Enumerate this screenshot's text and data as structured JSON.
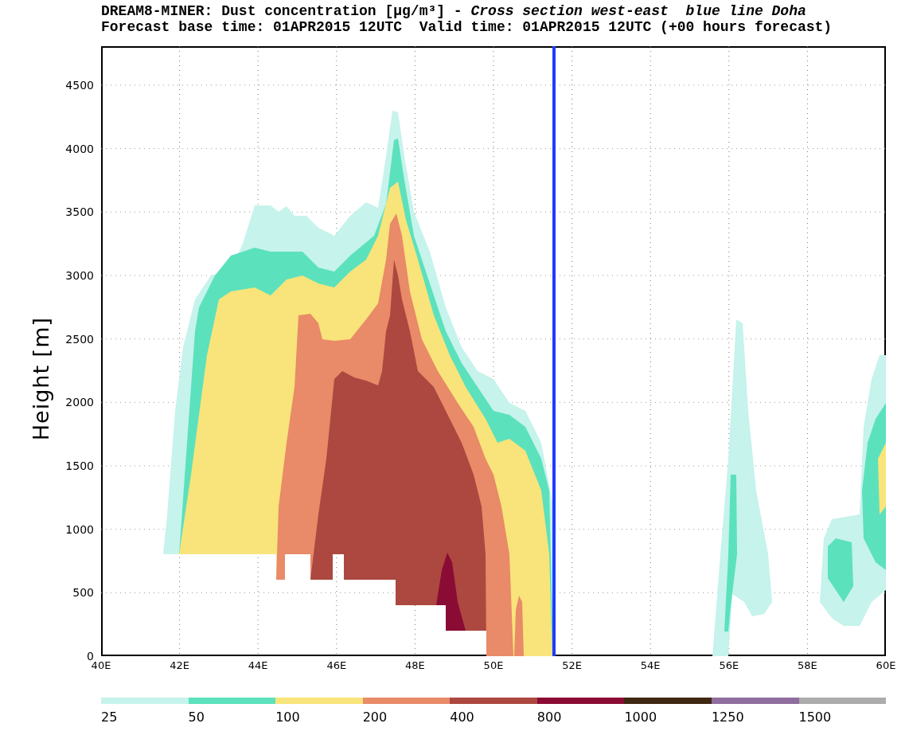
{
  "title": {
    "line_1": "DREAM8-MINER: Dust concentration [µg/m³] - *Cross section west-east  blue line Doha*",
    "line_2": "Forecast base time: 01APR2015 12UTC  Valid time: 01APR2015 12UTC (+00 hours forecast)"
  },
  "y_axis": {
    "label": "Height [m]",
    "ticks": [
      "4500",
      "4000",
      "3500",
      "3000",
      "2500",
      "2000",
      "1500",
      "1000",
      "500",
      "0"
    ]
  },
  "x_axis": {
    "ticks": [
      "40E",
      "42E",
      "44E",
      "46E",
      "48E",
      "50E",
      "52E",
      "54E",
      "56E",
      "58E",
      "60E"
    ]
  },
  "legend": [
    {
      "label": "25",
      "color": "#c6f3ec"
    },
    {
      "label": "50",
      "color": "#5ce1bd"
    },
    {
      "label": "100",
      "color": "#f8e47a"
    },
    {
      "label": "200",
      "color": "#e98a68"
    },
    {
      "label": "400",
      "color": "#ac4840"
    },
    {
      "label": "800",
      "color": "#8a0b34"
    },
    {
      "label": "1000",
      "color": "#3f2812"
    },
    {
      "label": "1250",
      "color": "#8f6d9e"
    },
    {
      "label": "1500",
      "color": "#acacac"
    }
  ]
}
